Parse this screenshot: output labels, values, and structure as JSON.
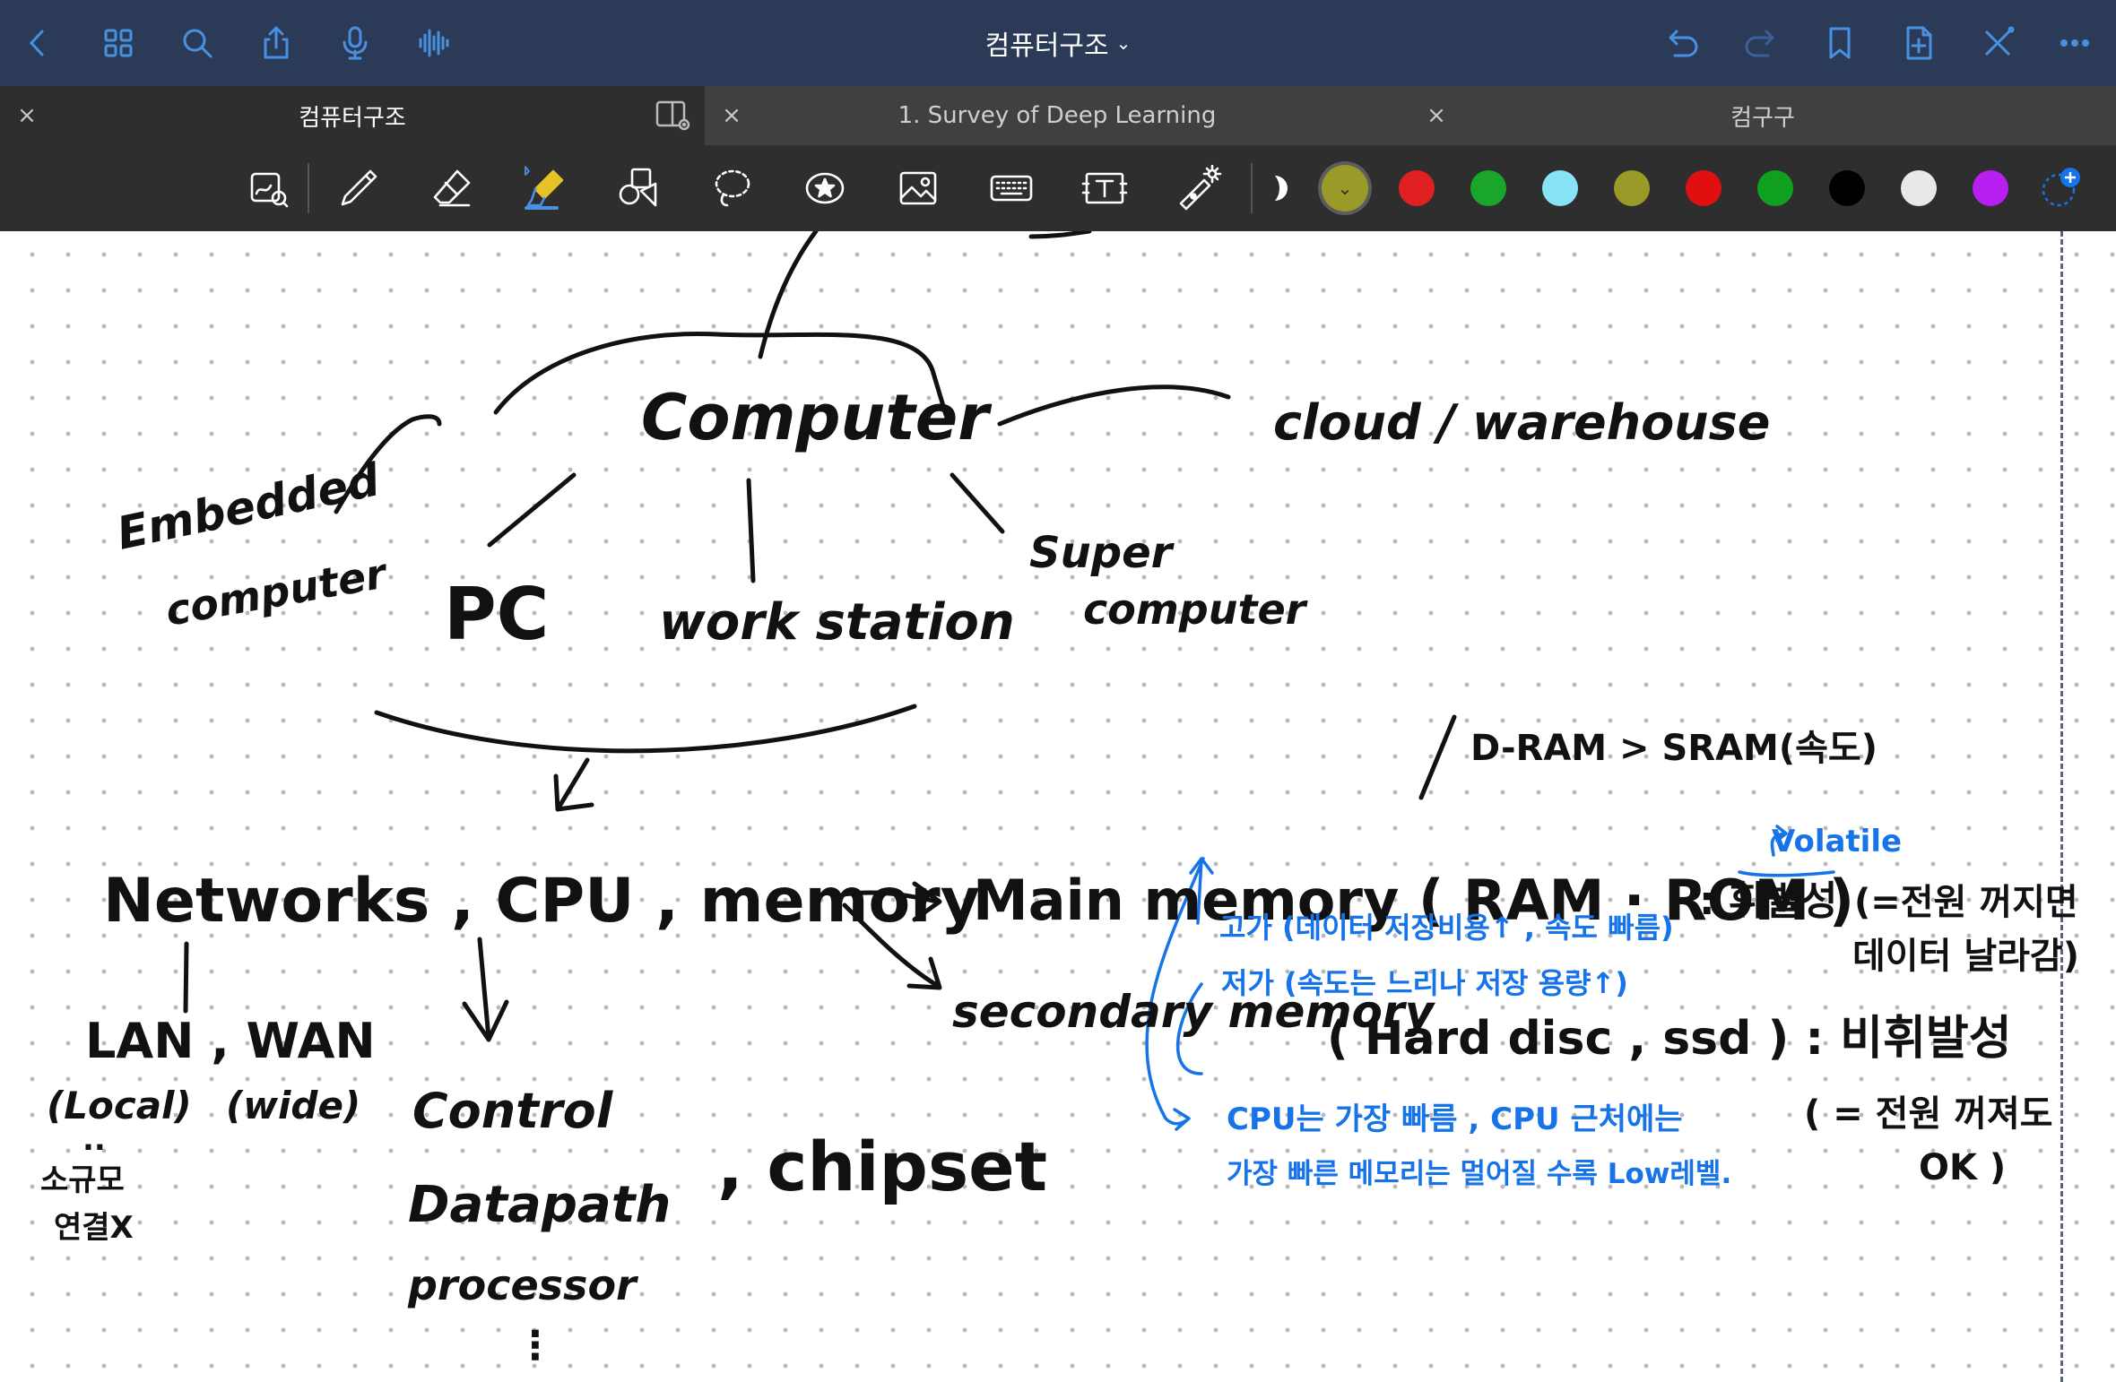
{
  "app": {
    "document_title": "컴퓨터구조",
    "title_chevron": "⌄"
  },
  "topbar": {
    "left_icons": [
      "back-icon",
      "grid-icon",
      "search-icon",
      "share-icon",
      "microphone-icon",
      "audio-wave-icon"
    ],
    "right_icons": [
      "undo-icon",
      "redo-icon",
      "bookmark-icon",
      "add-page-icon",
      "close-pen-icon",
      "more-icon"
    ]
  },
  "tabs": [
    {
      "label": "컴퓨터구조",
      "active": true
    },
    {
      "label": "1. Survey of Deep Learning",
      "active": false
    },
    {
      "label": "컴구구",
      "active": false
    }
  ],
  "tab_close_glyph": "×",
  "tools": [
    "lasso-zoom-icon",
    "pen-icon",
    "eraser-icon",
    "highlighter-icon",
    "shapes-icon",
    "lasso-icon",
    "sticker-icon",
    "image-icon",
    "keyboard-icon",
    "text-box-icon",
    "laser-pointer-icon"
  ],
  "colors": {
    "selected": "#9a9a28",
    "palette": [
      "#9a9a28",
      "#e02020",
      "#1aa62a",
      "#86e4f6",
      "#9a9a28",
      "#e01010",
      "#10a020",
      "#000000",
      "#e8e8e8",
      "#b71ef0"
    ],
    "ink_black": "#111111",
    "ink_blue": "#1673e8",
    "accent": "#4a90e2"
  },
  "notes": {
    "computer": "Computer",
    "cloud": "cloud / warehouse",
    "embedded_1": "Embedded",
    "embedded_2": "computer",
    "pc": "PC",
    "workstation": "work station",
    "super_1": "Super",
    "super_2": "computer",
    "dram": "D-RAM > SRAM(속도)",
    "volatile": "Volatile",
    "net_cpu_mem": "Networks , CPU , memory",
    "main_memory": "Main memory ( RAM · ROM )",
    "volatile_ko": ": 휘발성",
    "volatile_note_1": "(=전원 꺼지면",
    "volatile_note_2": "데이터 날라감)",
    "blue_expensive": "고가 (데이터 저장비용↑ , 속도 빠름)",
    "blue_cheap": "저가 (속도는 느리나 저장 용량↑)",
    "secondary_memory": "secondary memory",
    "hdd_ssd": "( Hard disc ,  ssd ) : 비휘발성",
    "nonvolatile_note_1": "( = 전원 꺼져도",
    "nonvolatile_note_2": "OK )",
    "blue_cpu_1": "CPU는 가장 빠름 , CPU 근처에는",
    "blue_cpu_2": "가장 빠른 메모리는 멀어질 수록 Low레벨.",
    "lan_wan": "LAN , WAN",
    "local": "(Local)",
    "wide": "(wide)",
    "dots": "..",
    "lan_note_1": "소규모",
    "lan_note_2": "연결X",
    "control": "Control",
    "datapath": "Datapath",
    "processor": "processor",
    "vdots": "⋮",
    "chipset": ", chipset"
  }
}
